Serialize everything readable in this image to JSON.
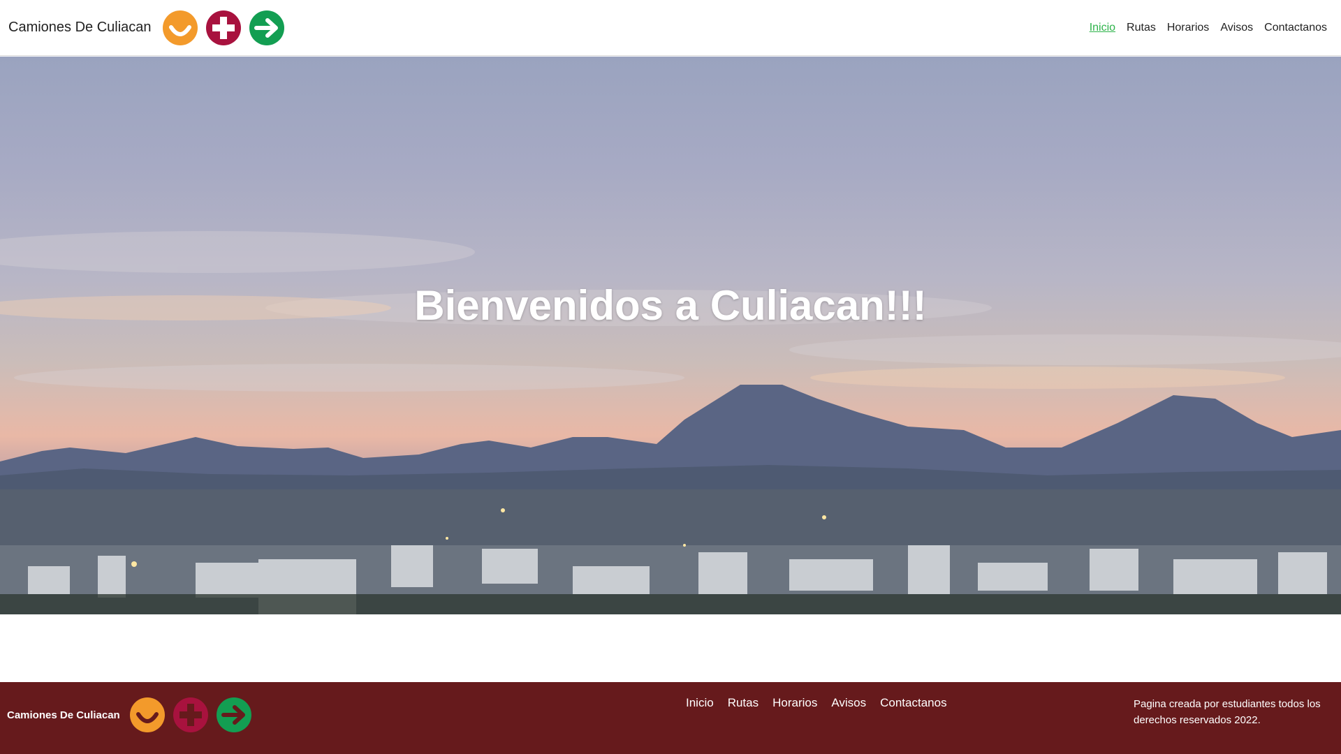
{
  "header": {
    "title": "Camiones De Culiacan",
    "nav": [
      {
        "label": "Inicio",
        "active": true
      },
      {
        "label": "Rutas",
        "active": false
      },
      {
        "label": "Horarios",
        "active": false
      },
      {
        "label": "Avisos",
        "active": false
      },
      {
        "label": "Contactanos",
        "active": false
      }
    ]
  },
  "logo": {
    "icons": [
      "smile-icon",
      "plus-icon",
      "arrow-right-icon"
    ],
    "colors": {
      "orange": "#f39a2b",
      "maroon": "#a8123e",
      "green": "#139e52"
    }
  },
  "hero": {
    "title": "Bienvenidos a Culiacan!!!",
    "image": "sunset-city-mountains-photo"
  },
  "footer": {
    "title": "Camiones De Culiacan",
    "nav": [
      "Inicio",
      "Rutas",
      "Horarios",
      "Avisos",
      "Contactanos"
    ],
    "note": "Pagina creada por estudiantes todos los derechos reservados 2022.",
    "background": "#661a1c"
  },
  "colors": {
    "active_link": "#2db34a"
  }
}
